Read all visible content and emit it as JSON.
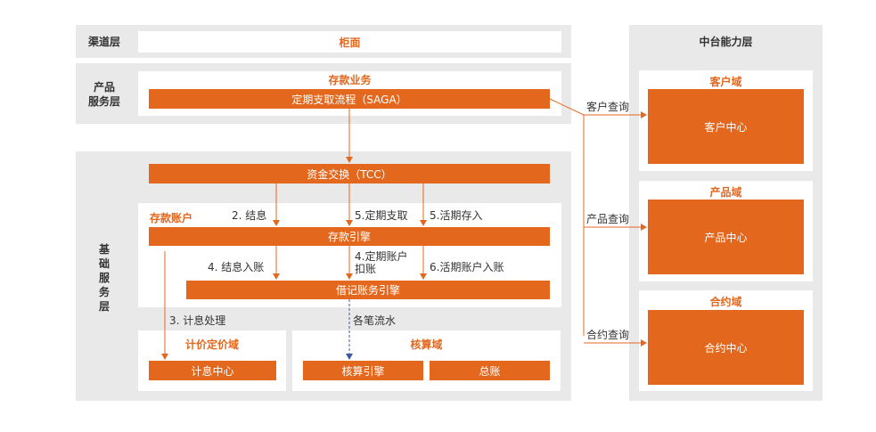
{
  "channel_layer": {
    "label": "渠道层",
    "counter": "柜面"
  },
  "product_layer": {
    "label_line1": "产品",
    "label_line2": "服务层",
    "deposit_business": "存款业务",
    "saga_flow": "定期支取流程（SAGA）"
  },
  "base_layer": {
    "label_chars": [
      "基",
      "础",
      "服",
      "务",
      "层"
    ],
    "tcc": "资金交换（TCC）",
    "deposit_account": "存款账户",
    "deposit_engine": "存款引擎",
    "debit_credit_engine": "借记账务引擎",
    "steps": {
      "s2": "2. 结息",
      "s5a": "5.定期支取",
      "s5b": "5.活期存入",
      "s4a": "4. 结息入账",
      "s4b_line1": "4.定期账户",
      "s4b_line2": "扣账",
      "s6": "6.活期账户入账",
      "s3": "3. 计息处理",
      "flow_each": "各笔流水"
    },
    "pricing_domain": {
      "title": "计价定价域",
      "center": "计息中心"
    },
    "accounting_domain": {
      "title": "核算域",
      "engine": "核算引擎",
      "ledger": "总账"
    }
  },
  "middle_platform": {
    "title": "中台能力层",
    "customer_domain": {
      "title": "客户域",
      "center": "客户中心",
      "query": "客户查询"
    },
    "product_domain": {
      "title": "产品域",
      "center": "产品中心",
      "query": "产品查询"
    },
    "contract_domain": {
      "title": "合约域",
      "center": "合约中心",
      "query": "合约查询"
    }
  },
  "colors": {
    "accent": "#e3681e",
    "panel_gray": "#e9e9e9",
    "arrow_blue": "#3a5ba0"
  }
}
